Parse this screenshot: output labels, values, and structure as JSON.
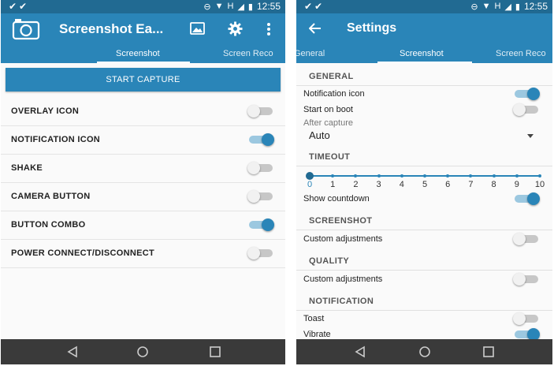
{
  "status_bar": {
    "time": "12:55",
    "network": "H"
  },
  "left_screen": {
    "app_title": "Screenshot Ea...",
    "tabs": [
      "Screenshot",
      "Screen Reco"
    ],
    "start_button": "START CAPTURE",
    "settings": [
      {
        "label": "OVERLAY ICON",
        "on": false
      },
      {
        "label": "NOTIFICATION ICON",
        "on": true
      },
      {
        "label": "SHAKE",
        "on": false
      },
      {
        "label": "CAMERA BUTTON",
        "on": false
      },
      {
        "label": "BUTTON COMBO",
        "on": true
      },
      {
        "label": "POWER CONNECT/DISCONNECT",
        "on": false
      }
    ]
  },
  "right_screen": {
    "title": "Settings",
    "tabs": [
      "General",
      "Screenshot",
      "Screen Reco"
    ],
    "general": {
      "header": "GENERAL",
      "notification_icon": {
        "label": "Notification icon",
        "on": true
      },
      "start_on_boot": {
        "label": "Start on boot",
        "on": false
      },
      "after_capture_label": "After capture",
      "after_capture_value": "Auto"
    },
    "timeout": {
      "header": "TIMEOUT",
      "ticks": [
        "0",
        "1",
        "2",
        "3",
        "4",
        "5",
        "6",
        "7",
        "8",
        "9",
        "10"
      ],
      "value": 0,
      "show_countdown": {
        "label": "Show countdown",
        "on": true
      }
    },
    "screenshot": {
      "header": "SCREENSHOT",
      "custom": {
        "label": "Custom adjustments",
        "on": false
      }
    },
    "quality": {
      "header": "QUALITY",
      "custom": {
        "label": "Custom adjustments",
        "on": false
      }
    },
    "notification": {
      "header": "NOTIFICATION",
      "toast": {
        "label": "Toast",
        "on": false
      },
      "vibrate": {
        "label": "Vibrate",
        "on": true
      }
    }
  },
  "colors": {
    "primary": "#2a85b8",
    "primary_dark": "#216a92",
    "navbar": "#3a3a3a"
  }
}
